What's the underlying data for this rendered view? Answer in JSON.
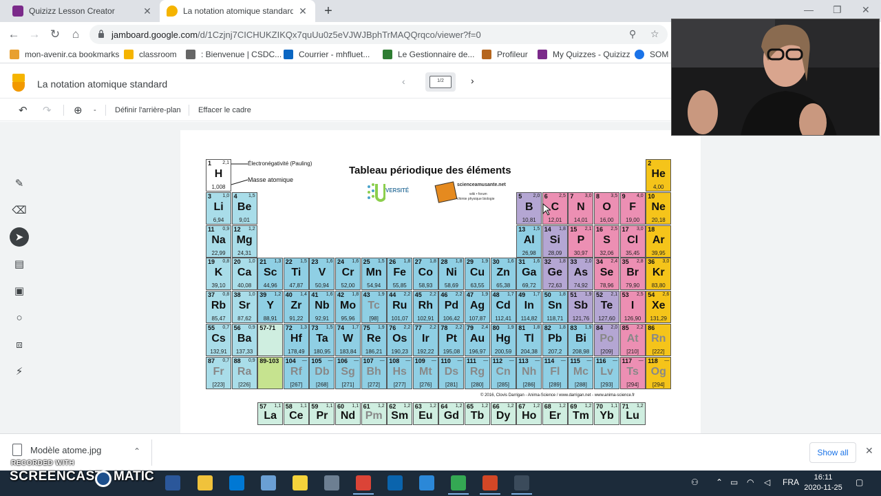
{
  "browser": {
    "tabs": [
      {
        "title": "Quizizz Lesson Creator",
        "active": false,
        "icon": "quizizz-icon"
      },
      {
        "title": "La notation atomique standard -",
        "active": true,
        "icon": "jamboard-icon"
      }
    ],
    "url_main": "jamboard.google.com",
    "url_rest": "/d/1Czjnj7CICHUKZIKQx7quUu0z5eVJWJBphTrMAQQrqco/viewer?f=0",
    "bookmarks": [
      {
        "label": "mon-avenir.ca bookmarks",
        "color": "#e8a02f"
      },
      {
        "label": "classroom",
        "color": "#f5b400"
      },
      {
        "label": ": Bienvenue | CSDC...",
        "color": "#666666"
      },
      {
        "label": "Courrier - mhfluet...",
        "color": "#0a66c2"
      },
      {
        "label": "Le Gestionnaire de...",
        "color": "#2e7d32"
      },
      {
        "label": "Profileur",
        "color": "#b5651d"
      },
      {
        "label": "My Quizzes - Quizizz",
        "color": "#7b2a8a"
      },
      {
        "label": "SOM",
        "color": "#1a73e8"
      }
    ]
  },
  "jamboard": {
    "title": "La notation atomique standard",
    "frame_counter": "1/2",
    "toolbar": {
      "zoom_minus": "-",
      "set_background": "Définir l'arrière-plan",
      "clear_frame": "Effacer le cadre"
    },
    "tools": [
      "pen-icon",
      "eraser-icon",
      "select-icon",
      "sticky-note-icon",
      "image-icon",
      "circle-icon",
      "text-box-icon",
      "laser-icon"
    ]
  },
  "periodic_table": {
    "title": "Tableau périodique des éléments",
    "legend_electronegativity": "Électronégativité (Pauling)",
    "legend_mass": "Masse atomique",
    "copyright": "© 2016, Clovis Darrigan - Anima-Science / www.darrigan.net - www.anima-science.fr",
    "logo_text": "VERSITÉ",
    "logo_site": "scienceamusante.net",
    "logo_subtitle_1": "wiki • forum",
    "logo_subtitle_2": "chimie physique biologie",
    "key": {
      "num": "1",
      "en": "2,1",
      "sym": "H",
      "mass": "1,008"
    },
    "elements": [
      {
        "n": "2",
        "s": "He",
        "m": "4,00",
        "e": "",
        "r": 0,
        "c": 17,
        "t": "ng"
      },
      {
        "n": "3",
        "s": "Li",
        "m": "6,94",
        "e": "1,0",
        "r": 1,
        "c": 0,
        "t": "am"
      },
      {
        "n": "4",
        "s": "Be",
        "m": "9,01",
        "e": "1,5",
        "r": 1,
        "c": 1,
        "t": "am"
      },
      {
        "n": "5",
        "s": "B",
        "m": "10,81",
        "e": "2,0",
        "r": 1,
        "c": 12,
        "t": "ml"
      },
      {
        "n": "6",
        "s": "C",
        "m": "12,01",
        "e": "2,5",
        "r": 1,
        "c": 13,
        "t": "nm"
      },
      {
        "n": "7",
        "s": "N",
        "m": "14,01",
        "e": "3,0",
        "r": 1,
        "c": 14,
        "t": "nm"
      },
      {
        "n": "8",
        "s": "O",
        "m": "16,00",
        "e": "3,5",
        "r": 1,
        "c": 15,
        "t": "nm"
      },
      {
        "n": "9",
        "s": "F",
        "m": "19,00",
        "e": "4,0",
        "r": 1,
        "c": 16,
        "t": "nm"
      },
      {
        "n": "10",
        "s": "Ne",
        "m": "20,18",
        "e": "",
        "r": 1,
        "c": 17,
        "t": "ng"
      },
      {
        "n": "11",
        "s": "Na",
        "m": "22,99",
        "e": "0,9",
        "r": 2,
        "c": 0,
        "t": "am"
      },
      {
        "n": "12",
        "s": "Mg",
        "m": "24,31",
        "e": "1,2",
        "r": 2,
        "c": 1,
        "t": "am"
      },
      {
        "n": "13",
        "s": "Al",
        "m": "26,98",
        "e": "1,5",
        "r": 2,
        "c": 12,
        "t": "mt"
      },
      {
        "n": "14",
        "s": "Si",
        "m": "28,09",
        "e": "1,8",
        "r": 2,
        "c": 13,
        "t": "ml"
      },
      {
        "n": "15",
        "s": "P",
        "m": "30,97",
        "e": "2,1",
        "r": 2,
        "c": 14,
        "t": "nm"
      },
      {
        "n": "16",
        "s": "S",
        "m": "32,06",
        "e": "2,5",
        "r": 2,
        "c": 15,
        "t": "nm"
      },
      {
        "n": "17",
        "s": "Cl",
        "m": "35,45",
        "e": "3,0",
        "r": 2,
        "c": 16,
        "t": "nm"
      },
      {
        "n": "18",
        "s": "Ar",
        "m": "39,95",
        "e": "",
        "r": 2,
        "c": 17,
        "t": "ng"
      },
      {
        "n": "19",
        "s": "K",
        "m": "39,10",
        "e": "0,8",
        "r": 3,
        "c": 0,
        "t": "am"
      },
      {
        "n": "20",
        "s": "Ca",
        "m": "40,08",
        "e": "1,0",
        "r": 3,
        "c": 1,
        "t": "am"
      },
      {
        "n": "21",
        "s": "Sc",
        "m": "44,96",
        "e": "1,3",
        "r": 3,
        "c": 2,
        "t": "mt"
      },
      {
        "n": "22",
        "s": "Ti",
        "m": "47,87",
        "e": "1,5",
        "r": 3,
        "c": 3,
        "t": "mt"
      },
      {
        "n": "23",
        "s": "V",
        "m": "50,94",
        "e": "1,6",
        "r": 3,
        "c": 4,
        "t": "mt"
      },
      {
        "n": "24",
        "s": "Cr",
        "m": "52,00",
        "e": "1,6",
        "r": 3,
        "c": 5,
        "t": "mt"
      },
      {
        "n": "25",
        "s": "Mn",
        "m": "54,94",
        "e": "1,5",
        "r": 3,
        "c": 6,
        "t": "mt"
      },
      {
        "n": "26",
        "s": "Fe",
        "m": "55,85",
        "e": "1,8",
        "r": 3,
        "c": 7,
        "t": "mt"
      },
      {
        "n": "27",
        "s": "Co",
        "m": "58,93",
        "e": "1,8",
        "r": 3,
        "c": 8,
        "t": "mt"
      },
      {
        "n": "28",
        "s": "Ni",
        "m": "58,69",
        "e": "1,8",
        "r": 3,
        "c": 9,
        "t": "mt"
      },
      {
        "n": "29",
        "s": "Cu",
        "m": "63,55",
        "e": "1,9",
        "r": 3,
        "c": 10,
        "t": "mt"
      },
      {
        "n": "30",
        "s": "Zn",
        "m": "65,38",
        "e": "1,6",
        "r": 3,
        "c": 11,
        "t": "mt"
      },
      {
        "n": "31",
        "s": "Ga",
        "m": "69,72",
        "e": "1,6",
        "r": 3,
        "c": 12,
        "t": "mt"
      },
      {
        "n": "32",
        "s": "Ge",
        "m": "72,63",
        "e": "1,8",
        "r": 3,
        "c": 13,
        "t": "ml"
      },
      {
        "n": "33",
        "s": "As",
        "m": "74,92",
        "e": "2,0",
        "r": 3,
        "c": 14,
        "t": "ml"
      },
      {
        "n": "34",
        "s": "Se",
        "m": "78,96",
        "e": "2,4",
        "r": 3,
        "c": 15,
        "t": "nm"
      },
      {
        "n": "35",
        "s": "Br",
        "m": "79,90",
        "e": "2,8",
        "r": 3,
        "c": 16,
        "t": "nm"
      },
      {
        "n": "36",
        "s": "Kr",
        "m": "83,80",
        "e": "3,0",
        "r": 3,
        "c": 17,
        "t": "ng"
      },
      {
        "n": "37",
        "s": "Rb",
        "m": "85,47",
        "e": "0,8",
        "r": 4,
        "c": 0,
        "t": "am"
      },
      {
        "n": "38",
        "s": "Sr",
        "m": "87,62",
        "e": "1,0",
        "r": 4,
        "c": 1,
        "t": "am"
      },
      {
        "n": "39",
        "s": "Y",
        "m": "88,91",
        "e": "1,2",
        "r": 4,
        "c": 2,
        "t": "mt"
      },
      {
        "n": "40",
        "s": "Zr",
        "m": "91,22",
        "e": "1,4",
        "r": 4,
        "c": 3,
        "t": "mt"
      },
      {
        "n": "41",
        "s": "Nb",
        "m": "92,91",
        "e": "1,6",
        "r": 4,
        "c": 4,
        "t": "mt"
      },
      {
        "n": "42",
        "s": "Mo",
        "m": "95,96",
        "e": "1,8",
        "r": 4,
        "c": 5,
        "t": "mt"
      },
      {
        "n": "43",
        "s": "Tc",
        "m": "[98]",
        "e": "1,9",
        "r": 4,
        "c": 6,
        "t": "mt",
        "f": true
      },
      {
        "n": "44",
        "s": "Ru",
        "m": "101,07",
        "e": "2,2",
        "r": 4,
        "c": 7,
        "t": "mt"
      },
      {
        "n": "45",
        "s": "Rh",
        "m": "102,91",
        "e": "2,2",
        "r": 4,
        "c": 8,
        "t": "mt"
      },
      {
        "n": "46",
        "s": "Pd",
        "m": "106,42",
        "e": "2,2",
        "r": 4,
        "c": 9,
        "t": "mt"
      },
      {
        "n": "47",
        "s": "Ag",
        "m": "107,87",
        "e": "1,9",
        "r": 4,
        "c": 10,
        "t": "mt"
      },
      {
        "n": "48",
        "s": "Cd",
        "m": "112,41",
        "e": "1,7",
        "r": 4,
        "c": 11,
        "t": "mt"
      },
      {
        "n": "49",
        "s": "In",
        "m": "114,82",
        "e": "1,7",
        "r": 4,
        "c": 12,
        "t": "mt"
      },
      {
        "n": "50",
        "s": "Sn",
        "m": "118,71",
        "e": "1,8",
        "r": 4,
        "c": 13,
        "t": "mt"
      },
      {
        "n": "51",
        "s": "Sb",
        "m": "121,76",
        "e": "1,9",
        "r": 4,
        "c": 14,
        "t": "ml"
      },
      {
        "n": "52",
        "s": "Te",
        "m": "127,60",
        "e": "2,1",
        "r": 4,
        "c": 15,
        "t": "ml"
      },
      {
        "n": "53",
        "s": "I",
        "m": "126,90",
        "e": "2,5",
        "r": 4,
        "c": 16,
        "t": "nm"
      },
      {
        "n": "54",
        "s": "Xe",
        "m": "131,29",
        "e": "2,6",
        "r": 4,
        "c": 17,
        "t": "ng"
      },
      {
        "n": "55",
        "s": "Cs",
        "m": "132,91",
        "e": "0,7",
        "r": 5,
        "c": 0,
        "t": "am"
      },
      {
        "n": "56",
        "s": "Ba",
        "m": "137,33",
        "e": "0,9",
        "r": 5,
        "c": 1,
        "t": "am"
      },
      {
        "n": "57-71",
        "s": "",
        "m": "",
        "e": "",
        "r": 5,
        "c": 2,
        "t": "la"
      },
      {
        "n": "72",
        "s": "Hf",
        "m": "178,49",
        "e": "1,3",
        "r": 5,
        "c": 3,
        "t": "mt"
      },
      {
        "n": "73",
        "s": "Ta",
        "m": "180,95",
        "e": "1,5",
        "r": 5,
        "c": 4,
        "t": "mt"
      },
      {
        "n": "74",
        "s": "W",
        "m": "183,84",
        "e": "1,7",
        "r": 5,
        "c": 5,
        "t": "mt"
      },
      {
        "n": "75",
        "s": "Re",
        "m": "186,21",
        "e": "1,9",
        "r": 5,
        "c": 6,
        "t": "mt"
      },
      {
        "n": "76",
        "s": "Os",
        "m": "190,23",
        "e": "2,2",
        "r": 5,
        "c": 7,
        "t": "mt"
      },
      {
        "n": "77",
        "s": "Ir",
        "m": "192,22",
        "e": "2,2",
        "r": 5,
        "c": 8,
        "t": "mt"
      },
      {
        "n": "78",
        "s": "Pt",
        "m": "195,08",
        "e": "2,2",
        "r": 5,
        "c": 9,
        "t": "mt"
      },
      {
        "n": "79",
        "s": "Au",
        "m": "196,97",
        "e": "2,4",
        "r": 5,
        "c": 10,
        "t": "mt"
      },
      {
        "n": "80",
        "s": "Hg",
        "m": "200,59",
        "e": "1,9",
        "r": 5,
        "c": 11,
        "t": "mt"
      },
      {
        "n": "81",
        "s": "Tl",
        "m": "204,38",
        "e": "1,8",
        "r": 5,
        "c": 12,
        "t": "mt"
      },
      {
        "n": "82",
        "s": "Pb",
        "m": "207,2",
        "e": "1,8",
        "r": 5,
        "c": 13,
        "t": "mt"
      },
      {
        "n": "83",
        "s": "Bi",
        "m": "208,98",
        "e": "1,9",
        "r": 5,
        "c": 14,
        "t": "mt"
      },
      {
        "n": "84",
        "s": "Po",
        "m": "[209]",
        "e": "2,0",
        "r": 5,
        "c": 15,
        "t": "ml",
        "f": true
      },
      {
        "n": "85",
        "s": "At",
        "m": "[210]",
        "e": "2,2",
        "r": 5,
        "c": 16,
        "t": "nm",
        "f": true
      },
      {
        "n": "86",
        "s": "Rn",
        "m": "[222]",
        "e": "",
        "r": 5,
        "c": 17,
        "t": "ng",
        "f": true
      },
      {
        "n": "87",
        "s": "Fr",
        "m": "[223]",
        "e": "0,7",
        "r": 6,
        "c": 0,
        "t": "am",
        "f": true
      },
      {
        "n": "88",
        "s": "Ra",
        "m": "[226]",
        "e": "0,9",
        "r": 6,
        "c": 1,
        "t": "am",
        "f": true
      },
      {
        "n": "89-103",
        "s": "",
        "m": "",
        "e": "",
        "r": 6,
        "c": 2,
        "t": "ac"
      },
      {
        "n": "104",
        "s": "Rf",
        "m": "[267]",
        "e": "—",
        "r": 6,
        "c": 3,
        "t": "mt",
        "f": true
      },
      {
        "n": "105",
        "s": "Db",
        "m": "[268]",
        "e": "—",
        "r": 6,
        "c": 4,
        "t": "mt",
        "f": true
      },
      {
        "n": "106",
        "s": "Sg",
        "m": "[271]",
        "e": "—",
        "r": 6,
        "c": 5,
        "t": "mt",
        "f": true
      },
      {
        "n": "107",
        "s": "Bh",
        "m": "[272]",
        "e": "—",
        "r": 6,
        "c": 6,
        "t": "mt",
        "f": true
      },
      {
        "n": "108",
        "s": "Hs",
        "m": "[277]",
        "e": "—",
        "r": 6,
        "c": 7,
        "t": "mt",
        "f": true
      },
      {
        "n": "109",
        "s": "Mt",
        "m": "[276]",
        "e": "—",
        "r": 6,
        "c": 8,
        "t": "mt",
        "f": true
      },
      {
        "n": "110",
        "s": "Ds",
        "m": "[281]",
        "e": "—",
        "r": 6,
        "c": 9,
        "t": "mt",
        "f": true
      },
      {
        "n": "111",
        "s": "Rg",
        "m": "[280]",
        "e": "—",
        "r": 6,
        "c": 10,
        "t": "mt",
        "f": true
      },
      {
        "n": "112",
        "s": "Cn",
        "m": "[285]",
        "e": "—",
        "r": 6,
        "c": 11,
        "t": "mt",
        "f": true
      },
      {
        "n": "113",
        "s": "Nh",
        "m": "[286]",
        "e": "—",
        "r": 6,
        "c": 12,
        "t": "mt",
        "f": true
      },
      {
        "n": "114",
        "s": "Fl",
        "m": "[289]",
        "e": "—",
        "r": 6,
        "c": 13,
        "t": "mt",
        "f": true
      },
      {
        "n": "115",
        "s": "Mc",
        "m": "[288]",
        "e": "—",
        "r": 6,
        "c": 14,
        "t": "mt",
        "f": true
      },
      {
        "n": "116",
        "s": "Lv",
        "m": "[293]",
        "e": "—",
        "r": 6,
        "c": 15,
        "t": "mt",
        "f": true
      },
      {
        "n": "117",
        "s": "Ts",
        "m": "[294]",
        "e": "—",
        "r": 6,
        "c": 16,
        "t": "nm",
        "f": true
      },
      {
        "n": "118",
        "s": "Og",
        "m": "[294]",
        "e": "—",
        "r": 6,
        "c": 17,
        "t": "ng",
        "f": true
      }
    ],
    "lanthanides": [
      {
        "n": "57",
        "s": "La",
        "e": "1,1"
      },
      {
        "n": "58",
        "s": "Ce",
        "e": "1,1"
      },
      {
        "n": "59",
        "s": "Pr",
        "e": "1,1"
      },
      {
        "n": "60",
        "s": "Nd",
        "e": "1,1"
      },
      {
        "n": "61",
        "s": "Pm",
        "e": "1,2",
        "f": true
      },
      {
        "n": "62",
        "s": "Sm",
        "e": "1,2"
      },
      {
        "n": "63",
        "s": "Eu",
        "e": "1,2"
      },
      {
        "n": "64",
        "s": "Gd",
        "e": "1,2"
      },
      {
        "n": "65",
        "s": "Tb",
        "e": "1,2"
      },
      {
        "n": "66",
        "s": "Dy",
        "e": "1,2"
      },
      {
        "n": "67",
        "s": "Ho",
        "e": "1,2"
      },
      {
        "n": "68",
        "s": "Er",
        "e": "1,2"
      },
      {
        "n": "69",
        "s": "Tm",
        "e": "1,2"
      },
      {
        "n": "70",
        "s": "Yb",
        "e": "1,1"
      },
      {
        "n": "71",
        "s": "Lu",
        "e": "1,2"
      }
    ],
    "colors": {
      "am": "#a9dde9",
      "mt": "#8fcfe4",
      "ml": "#b4a6d3",
      "nm": "#ec8fb3",
      "ng": "#f5c41a",
      "la": "#cfeee0",
      "ac": "#c6e38f",
      "key": "#ececec"
    }
  },
  "downloads": {
    "file_name": "Modèle atome.jpg",
    "show_all": "Show all"
  },
  "watermark": {
    "small": "RECORDED WITH",
    "big": "SCREENCAST",
    "big2": "MATIC"
  },
  "taskbar": {
    "language": "FRA",
    "time": "16:11",
    "date": "2020-11-25",
    "apps": [
      {
        "name": "word-app-icon",
        "color": "#2b579a"
      },
      {
        "name": "file-explorer-icon",
        "color": "#f0c23b"
      },
      {
        "name": "mail-app-icon",
        "color": "#0078d4"
      },
      {
        "name": "paint-app-icon",
        "color": "#6a9fd4"
      },
      {
        "name": "sticky-notes-app-icon",
        "color": "#f5d33b"
      },
      {
        "name": "camera-app-icon",
        "color": "#6d7f92"
      },
      {
        "name": "chrome-app-icon",
        "color": "#db4437"
      },
      {
        "name": "outlook-app-icon",
        "color": "#0a64ad"
      },
      {
        "name": "notepad-app-icon",
        "color": "#2b88d8"
      },
      {
        "name": "chrome-profile-app-icon",
        "color": "#34a853"
      },
      {
        "name": "powerpoint-app-icon",
        "color": "#d24726"
      },
      {
        "name": "snipping-app-icon",
        "color": "#3b4b5b"
      }
    ]
  }
}
